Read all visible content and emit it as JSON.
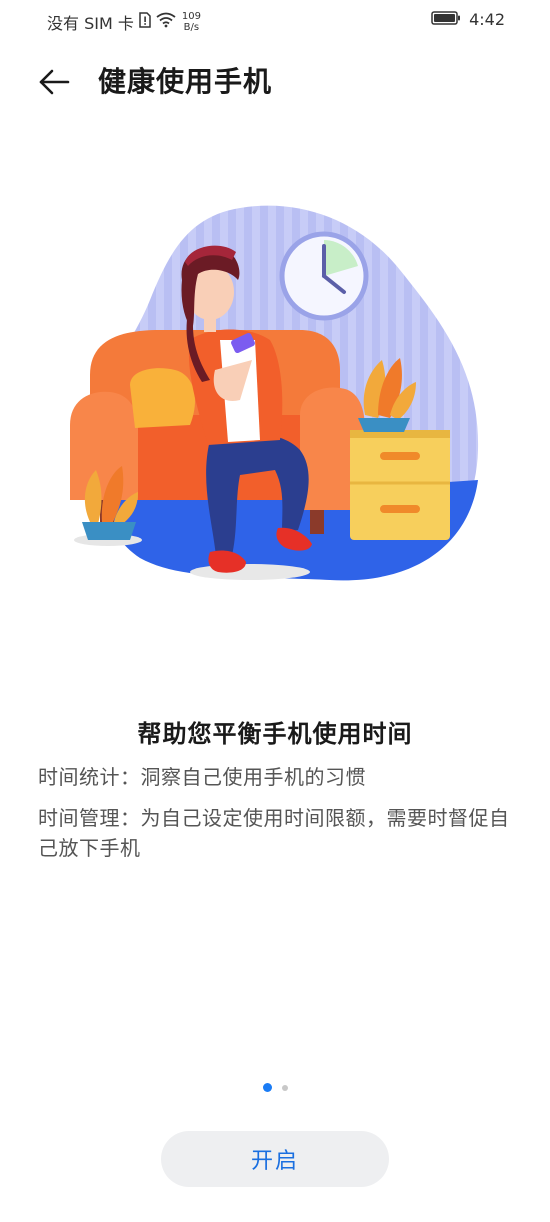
{
  "status_bar": {
    "carrier": "没有 SIM 卡",
    "speed_value": "109",
    "speed_unit": "B/s",
    "time": "4:42"
  },
  "header": {
    "title": "健康使用手机"
  },
  "content": {
    "heading": "帮助您平衡手机使用时间",
    "line1": "时间统计：洞察自己使用手机的习惯",
    "line2": "时间管理：为自己设定使用时间限额，需要时督促自己放下手机"
  },
  "pager": {
    "current": 1,
    "total": 2
  },
  "actions": {
    "enable_label": "开启"
  },
  "colors": {
    "accent": "#1a7cf5",
    "button_text": "#1a6fe0",
    "button_bg": "#eeeff1"
  }
}
